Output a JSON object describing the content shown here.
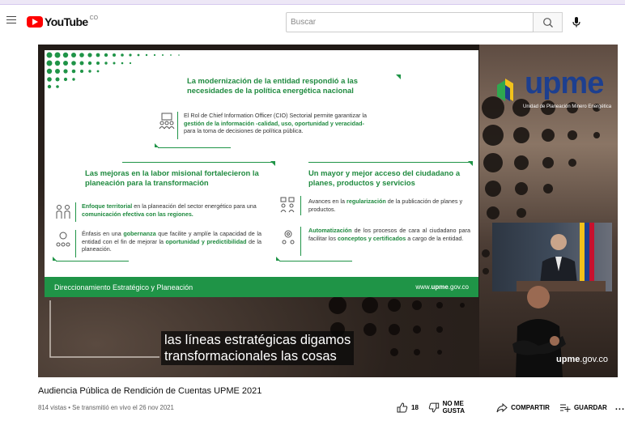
{
  "header": {
    "logo_text": "YouTube",
    "logo_country": "CO",
    "search_placeholder": "Buscar"
  },
  "slide": {
    "heading1": "La modernización de la entidad respondió a las necesidades de la política energética nacional",
    "text1_a": "El Rol de Chief Information Officer (CIO) Sectorial permite garantizar la ",
    "text1_b": "gestión de la información -calidad, uso, oportunidad y veracidad-",
    "text1_c": " para la toma de decisiones de política pública.",
    "heading2": "Las mejoras en la labor misional fortalecieron la planeación para la transformación",
    "text2_a": "Enfoque territorial",
    "text2_b": " en la planeación del sector energético para una ",
    "text2_c": "comunicación efectiva con las regiones.",
    "text3_a": "Énfasis en una ",
    "text3_b": "gobernanza",
    "text3_c": " que facilite y amplíe la capacidad de la entidad con el fin de mejorar la ",
    "text3_d": "oportunidad y predictibilidad",
    "text3_e": " de la planeación.",
    "heading3": "Un mayor y mejor acceso del ciudadano a planes, productos y servicios",
    "text4_a": "Avances en la ",
    "text4_b": "regularización",
    "text4_c": " de la publicación de planes y productos.",
    "text5_a": "Automatización",
    "text5_b": " de los procesos de cara al ciudadano para facilitar los ",
    "text5_c": "conceptos y certificados",
    "text5_d": " a cargo de la entidad.",
    "footer_left": "Direccionamiento Estratégico y Planeación",
    "footer_right_pre": "www.",
    "footer_right_bold": "upme",
    "footer_right_post": ".gov.co"
  },
  "brand": {
    "logo": "upme",
    "subtitle": "Unidad de Planeación Minero Energética",
    "watermark_bold": "upme",
    "watermark_rest": ".gov.co"
  },
  "caption": {
    "line1": "las líneas estratégicas digamos",
    "line2": "transformacionales las cosas"
  },
  "video": {
    "title": "Audiencia Pública de Rendición de Cuentas UPME 2021",
    "meta": "814 vistas • Se transmitió en vivo el 26 nov 2021"
  },
  "actions": {
    "likes": "18",
    "dislike": "NO ME GUSTA",
    "share": "COMPARTIR",
    "save": "GUARDAR",
    "more": "..."
  },
  "colors": {
    "slide_green": "#1f9447",
    "upme_blue": "#1d3f8f",
    "youtube_red": "#ff0000"
  }
}
